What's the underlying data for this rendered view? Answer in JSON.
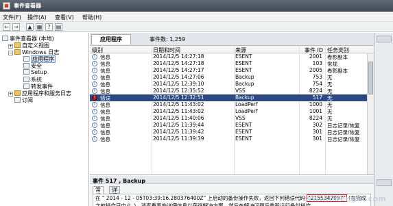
{
  "window": {
    "title": "事件查看器"
  },
  "menu": [
    "文件(F)",
    "操作(A)",
    "查看(V)",
    "帮助(H)"
  ],
  "toolbar": [
    "←",
    "→",
    "▲",
    "▦",
    "?",
    "▤"
  ],
  "tree": [
    {
      "label": "事件查看器 (本地)",
      "indent": 0,
      "icon": "computer",
      "expander": ""
    },
    {
      "label": "自定义视图",
      "indent": 1,
      "icon": "folder",
      "expander": "+"
    },
    {
      "label": "Windows 日志",
      "indent": 1,
      "icon": "folder",
      "expander": "−"
    },
    {
      "label": "应用程序",
      "indent": 2,
      "icon": "log",
      "expander": "",
      "selected": true
    },
    {
      "label": "安全",
      "indent": 2,
      "icon": "log",
      "expander": ""
    },
    {
      "label": "Setup",
      "indent": 2,
      "icon": "log",
      "expander": ""
    },
    {
      "label": "系统",
      "indent": 2,
      "icon": "log",
      "expander": ""
    },
    {
      "label": "转发事件",
      "indent": 2,
      "icon": "log",
      "expander": ""
    },
    {
      "label": "应用程序和服务日志",
      "indent": 1,
      "icon": "folder",
      "expander": "+"
    },
    {
      "label": "订阅",
      "indent": 1,
      "icon": "log",
      "expander": ""
    }
  ],
  "pane": {
    "tab_label": "应用程序",
    "count_text": "事件数: 1,259"
  },
  "columns": [
    "级别",
    "日期和时间",
    "来源",
    "事件 ID",
    "任务类别"
  ],
  "rows": [
    [
      "信息",
      "2014/12/5 14:27:18",
      "ESENT",
      "2001",
      "卷影副本"
    ],
    [
      "信息",
      "2014/12/5 14:27:18",
      "ESENT",
      "103",
      "常规"
    ],
    [
      "信息",
      "2014/12/5 14:27:17",
      "ESENT",
      "2005",
      "卷影副本"
    ],
    [
      "信息",
      "2014/12/5 14:27:06",
      "Backup",
      "753",
      "无"
    ],
    [
      "信息",
      "2014/12/5 12:39:10",
      "Backup",
      "754",
      "无"
    ],
    [
      "信息",
      "2014/12/5 12:35:52",
      "VSS",
      "8224",
      "无"
    ],
    [
      "错误",
      "2014/12/5 12:32:51",
      "Backup",
      "517",
      "无"
    ],
    [
      "信息",
      "2014/12/5 11:43:02",
      "LoadPerf",
      "1000",
      "无"
    ],
    [
      "信息",
      "2014/12/5 11:43:02",
      "LoadPerf",
      "1001",
      "无"
    ],
    [
      "信息",
      "2014/12/5 11:40:06",
      "VSS",
      "8224",
      "无"
    ],
    [
      "信息",
      "2014/12/5 11:39:44",
      "ESENT",
      "302",
      "日志记录/恢复"
    ],
    [
      "信息",
      "2014/12/5 11:39:42",
      "ESENT",
      "301",
      "日志记录/恢复"
    ],
    [
      "信息",
      "2014/12/5 11:39:39",
      "ESENT",
      "301",
      "日志记录/恢复"
    ]
  ],
  "selected_row": 6,
  "detail": {
    "title": "事件 517 , Backup",
    "tabs": [
      "常规",
      "详细信息"
    ],
    "text_before": "在 \" 2014 - 12 - 05T03:39:16.280376400Z\" 上启动的备份操作失败，返回下列错误代码 ",
    "error_code": "\"2155347997\"",
    "text_after": " (在完成之前操作已中止。)。请查看事件详细信息以获得解决方案，然后在解决问题后重新运行备份操作。"
  },
  "watermark": "www.lidongni.com"
}
